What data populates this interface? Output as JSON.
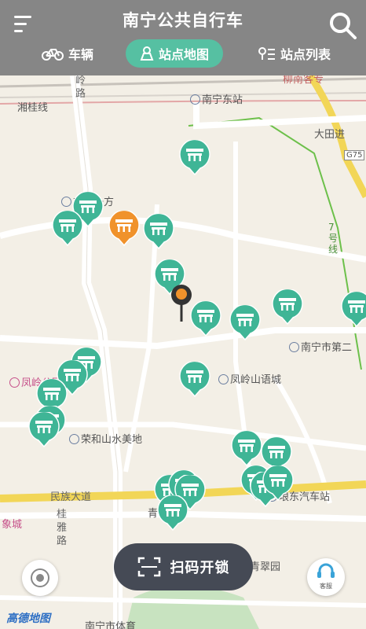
{
  "header": {
    "title": "南宁公共自行车",
    "tabs": [
      {
        "label": "车辆",
        "icon": "bicycle-icon"
      },
      {
        "label": "站点地图",
        "icon": "map-icon",
        "active": true
      },
      {
        "label": "站点列表",
        "icon": "list-icon"
      }
    ]
  },
  "map": {
    "labels": {
      "nanning_east": "南宁东站",
      "xianggui": "湘桂线",
      "fenghuangling": "凤凰岭路",
      "liuliang": "柳南客专",
      "datianjin": "大田进",
      "g75": "G75",
      "zaishuiyifang": "在水一方",
      "line7": "7号线",
      "nanning_2nd": "南宁市第二",
      "fenglingshanyu": "凤岭山语城",
      "fenglingpark": "凤岭公园",
      "ronghe": "荣和山水美地",
      "minzu": "民族大道",
      "langdong": "埌东汽车站",
      "xiangcheng": "象城",
      "guiyalu": "桂雅路",
      "qingcuiyuan": "青翠园",
      "nanning_sport": "南宁市体育",
      "qing": "青"
    },
    "provider": "高德地图"
  },
  "controls": {
    "scan_label": "扫码开锁",
    "service_label": "客服"
  },
  "colors": {
    "header_bg": "#868686",
    "tab_active": "#56c0a2",
    "marker": "#3fb596",
    "marker_selected": "#f0922b",
    "scan_bg": "#454a55",
    "road_main": "#f6e06d"
  }
}
